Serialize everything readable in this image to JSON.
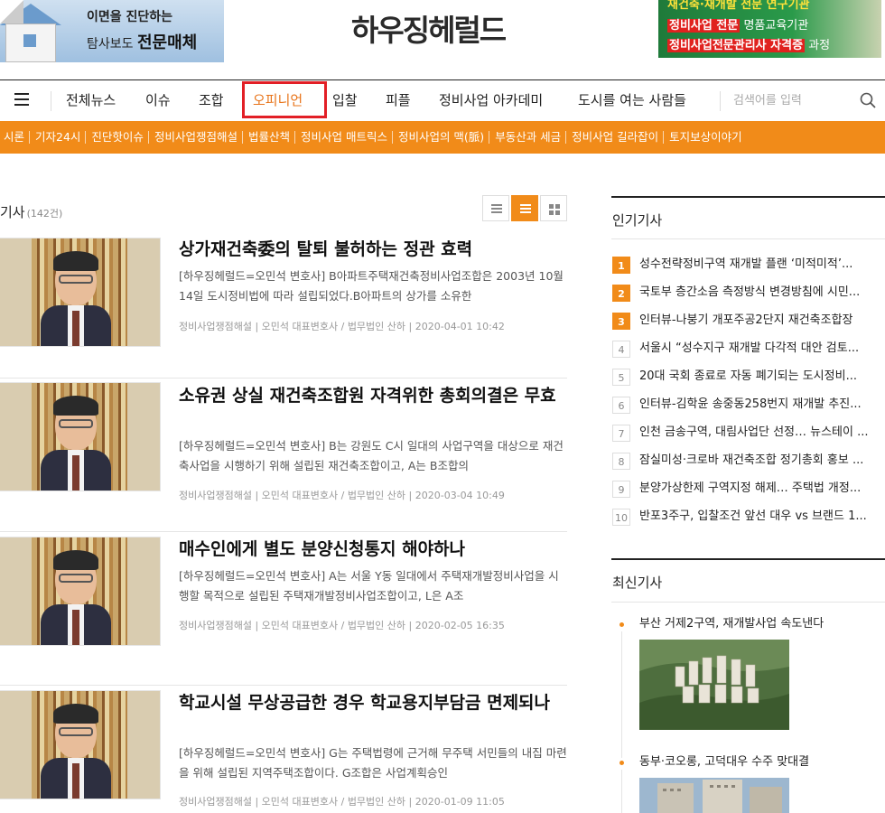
{
  "banner": {
    "left_ad": {
      "line1": "이면을 진단하는",
      "line2a": "탐사보도",
      "line2b": "전문매체"
    },
    "logo": "하우징헤럴드",
    "right_ad": {
      "line1": "재건축·재개발 전문 연구기관",
      "line2a": "정비사업 전문",
      "line2b": "명품교육기관",
      "line3a": "정비사업전문관리사 자격증",
      "line3b": "과정"
    }
  },
  "nav": {
    "items": [
      "전체뉴스",
      "이슈",
      "조합",
      "오피니언",
      "입찰",
      "피플",
      "정비사업 아카데미",
      "도시를 여는 사람들"
    ],
    "active": "오피니언",
    "search_placeholder": "검색어를 입력"
  },
  "subnav": {
    "items": [
      "시론",
      "기자24시",
      "진단핫이슈",
      "정비사업쟁점해설",
      "법률산책",
      "정비사업 매트릭스",
      "정비사업의 맥(脈)",
      "부동산과 세금",
      "정비사업 길라잡이",
      "토지보상이야기"
    ]
  },
  "list": {
    "title": "기사",
    "count": "(142건)",
    "articles": [
      {
        "title": "상가재건축委의 탈퇴 불허하는 정관 효력",
        "summary": "[하우징헤럴드=오민석 변호사] B아파트주택재건축정비사업조합은 2003년 10월 14일 도시정비법에 따라 설립되었다.B아파트의 상가를 소유한",
        "meta": "정비사업쟁점해설 | 오민석 대표변호사 / 법무법인 산하 | 2020-04-01 10:42"
      },
      {
        "title": "소유권 상실 재건축조합원 자격위한 총회의결은 무효",
        "summary": "[하우징헤럴드=오민석 변호사] B는 강원도 C시 일대의 사업구역을 대상으로 재건축사업을 시행하기 위해 설립된 재건축조합이고, A는 B조합의",
        "meta": "정비사업쟁점해설 | 오민석 대표변호사 / 법무법인 산하 | 2020-03-04 10:49"
      },
      {
        "title": "매수인에게 별도 분양신청통지 해야하나",
        "summary": "[하우징헤럴드=오민석 변호사] A는 서울 Y동 일대에서 주택재개발정비사업을 시행할 목적으로 설립된 주택재개발정비사업조합이고, L은 A조",
        "meta": "정비사업쟁점해설 | 오민석 대표변호사 / 법무법인 산하 | 2020-02-05 16:35"
      },
      {
        "title": "학교시설 무상공급한 경우 학교용지부담금 면제되나",
        "summary": "[하우징헤럴드=오민석 변호사] G는 주택법령에 근거해 무주택 서민들의 내집 마련을 위해 설립된 지역주택조합이다. G조합은 사업계획승인",
        "meta": "정비사업쟁점해설 | 오민석 대표변호사 / 법무법인 산하 | 2020-01-09 11:05"
      }
    ]
  },
  "sidebar": {
    "popular_title": "인기기사",
    "popular": [
      {
        "rank": "1",
        "text": "성수전략정비구역 재개발 플랜 ‘미적미적’..."
      },
      {
        "rank": "2",
        "text": "국토부 층간소음 측정방식 변경방침에 시민..."
      },
      {
        "rank": "3",
        "text": "인터뷰-나붕기 개포주공2단지 재건축조합장"
      },
      {
        "rank": "4",
        "text": "서울시 “성수지구 재개발 다각적 대안 검토..."
      },
      {
        "rank": "5",
        "text": "20대 국회 종료로 자동 폐기되는 도시정비..."
      },
      {
        "rank": "6",
        "text": "인터뷰-김학윤 송중동258번지 재개발 추진..."
      },
      {
        "rank": "7",
        "text": "인천 금송구역, 대림사업단 선정… 뉴스테이 ..."
      },
      {
        "rank": "8",
        "text": "잠실미성·크로바 재건축조합 정기총회 홍보 ..."
      },
      {
        "rank": "9",
        "text": "분양가상한제 구역지정 해제… 주택법 개정..."
      },
      {
        "rank": "10",
        "text": "반포3주구, 입찰조건 앞선 대우 vs 브랜드 1..."
      }
    ],
    "latest_title": "최신기사",
    "latest": [
      {
        "title": "부산 거제2구역, 재개발사업 속도낸다"
      },
      {
        "title": "동부·코오롱, 고덕대우 수주 맞대결"
      }
    ]
  },
  "colors": {
    "accent": "#f18b19",
    "highlight_box": "#e21f26"
  }
}
